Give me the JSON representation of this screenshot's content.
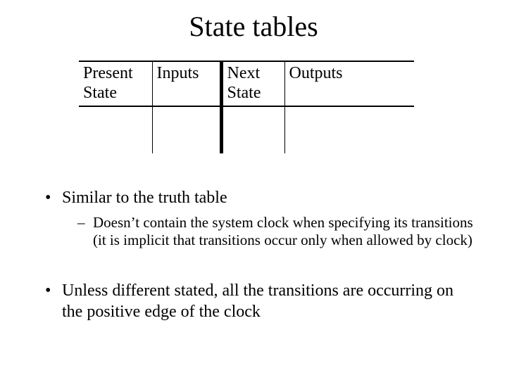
{
  "title": "State tables",
  "table": {
    "headers": [
      "Present State",
      "Inputs",
      "Next State",
      "Outputs"
    ]
  },
  "bullets": {
    "b1": "Similar to the truth table",
    "b1_sub": "Doesn’t contain the system clock when specifying its transitions (it is implicit that transitions occur only when allowed by clock)",
    "b2": "Unless different stated, all the transitions are occurring on the positive edge of the clock"
  }
}
